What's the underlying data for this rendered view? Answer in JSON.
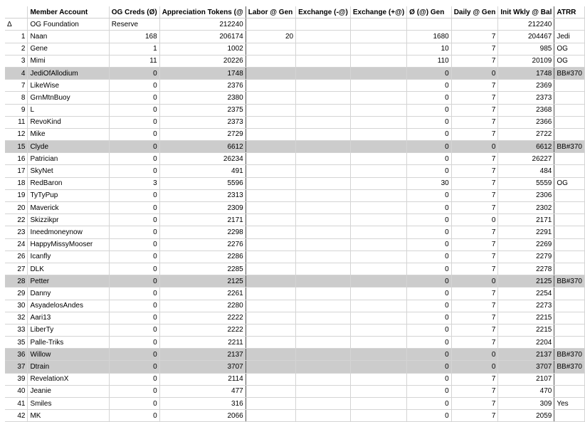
{
  "columns": {
    "idx": "",
    "account": "Member Account",
    "og": "OG Creds (Ø)",
    "tokens": "Appreciation Tokens (@",
    "labor": "Labor @ Gen",
    "exneg": "Exchange (-@)",
    "expos": "Exchange (+@)",
    "ogen": "Ø (@) Gen",
    "daily": "Daily @ Gen",
    "init": "Init Wkly @ Bal",
    "atrr": "ATRR"
  },
  "rows": [
    {
      "idx": "Δ",
      "account": "OG Foundation",
      "og": "Reserve",
      "tokens": "212240",
      "labor": "",
      "exneg": "",
      "expos": "",
      "ogen": "",
      "daily": "",
      "init": "212240",
      "atrr": "",
      "hl": false
    },
    {
      "idx": "1",
      "account": "Naan",
      "og": "168",
      "tokens": "206174",
      "labor": "20",
      "exneg": "",
      "expos": "",
      "ogen": "1680",
      "daily": "7",
      "init": "204467",
      "atrr": "Jedi",
      "hl": false
    },
    {
      "idx": "2",
      "account": "Gene",
      "og": "1",
      "tokens": "1002",
      "labor": "",
      "exneg": "",
      "expos": "",
      "ogen": "10",
      "daily": "7",
      "init": "985",
      "atrr": "OG",
      "hl": false
    },
    {
      "idx": "3",
      "account": "Mimi",
      "og": "11",
      "tokens": "20226",
      "labor": "",
      "exneg": "",
      "expos": "",
      "ogen": "110",
      "daily": "7",
      "init": "20109",
      "atrr": "OG",
      "hl": false
    },
    {
      "idx": "4",
      "account": "JediOfAllodium",
      "og": "0",
      "tokens": "1748",
      "labor": "",
      "exneg": "",
      "expos": "",
      "ogen": "0",
      "daily": "0",
      "init": "1748",
      "atrr": "BB#370",
      "hl": true
    },
    {
      "idx": "7",
      "account": "LikeWise",
      "og": "0",
      "tokens": "2376",
      "labor": "",
      "exneg": "",
      "expos": "",
      "ogen": "0",
      "daily": "7",
      "init": "2369",
      "atrr": "",
      "hl": false
    },
    {
      "idx": "8",
      "account": "GrnMtnBuoy",
      "og": "0",
      "tokens": "2380",
      "labor": "",
      "exneg": "",
      "expos": "",
      "ogen": "0",
      "daily": "7",
      "init": "2373",
      "atrr": "",
      "hl": false
    },
    {
      "idx": "9",
      "account": "L",
      "og": "0",
      "tokens": "2375",
      "labor": "",
      "exneg": "",
      "expos": "",
      "ogen": "0",
      "daily": "7",
      "init": "2368",
      "atrr": "",
      "hl": false
    },
    {
      "idx": "11",
      "account": "RevoKind",
      "og": "0",
      "tokens": "2373",
      "labor": "",
      "exneg": "",
      "expos": "",
      "ogen": "0",
      "daily": "7",
      "init": "2366",
      "atrr": "",
      "hl": false
    },
    {
      "idx": "12",
      "account": "Mike",
      "og": "0",
      "tokens": "2729",
      "labor": "",
      "exneg": "",
      "expos": "",
      "ogen": "0",
      "daily": "7",
      "init": "2722",
      "atrr": "",
      "hl": false
    },
    {
      "idx": "15",
      "account": "Clyde",
      "og": "0",
      "tokens": "6612",
      "labor": "",
      "exneg": "",
      "expos": "",
      "ogen": "0",
      "daily": "0",
      "init": "6612",
      "atrr": "BB#370",
      "hl": true
    },
    {
      "idx": "16",
      "account": "Patrician",
      "og": "0",
      "tokens": "26234",
      "labor": "",
      "exneg": "",
      "expos": "",
      "ogen": "0",
      "daily": "7",
      "init": "26227",
      "atrr": "",
      "hl": false
    },
    {
      "idx": "17",
      "account": "SkyNet",
      "og": "0",
      "tokens": "491",
      "labor": "",
      "exneg": "",
      "expos": "",
      "ogen": "0",
      "daily": "7",
      "init": "484",
      "atrr": "",
      "hl": false
    },
    {
      "idx": "18",
      "account": "RedBaron",
      "og": "3",
      "tokens": "5596",
      "labor": "",
      "exneg": "",
      "expos": "",
      "ogen": "30",
      "daily": "7",
      "init": "5559",
      "atrr": "OG",
      "hl": false
    },
    {
      "idx": "19",
      "account": "TyTyPup",
      "og": "0",
      "tokens": "2313",
      "labor": "",
      "exneg": "",
      "expos": "",
      "ogen": "0",
      "daily": "7",
      "init": "2306",
      "atrr": "",
      "hl": false
    },
    {
      "idx": "20",
      "account": "Maverick",
      "og": "0",
      "tokens": "2309",
      "labor": "",
      "exneg": "",
      "expos": "",
      "ogen": "0",
      "daily": "7",
      "init": "2302",
      "atrr": "",
      "hl": false
    },
    {
      "idx": "22",
      "account": "Skizzikpr",
      "og": "0",
      "tokens": "2171",
      "labor": "",
      "exneg": "",
      "expos": "",
      "ogen": "0",
      "daily": "0",
      "init": "2171",
      "atrr": "",
      "hl": false
    },
    {
      "idx": "23",
      "account": "Ineedmoneynow",
      "og": "0",
      "tokens": "2298",
      "labor": "",
      "exneg": "",
      "expos": "",
      "ogen": "0",
      "daily": "7",
      "init": "2291",
      "atrr": "",
      "hl": false
    },
    {
      "idx": "24",
      "account": "HappyMissyMooser",
      "og": "0",
      "tokens": "2276",
      "labor": "",
      "exneg": "",
      "expos": "",
      "ogen": "0",
      "daily": "7",
      "init": "2269",
      "atrr": "",
      "hl": false
    },
    {
      "idx": "26",
      "account": "Icanfly",
      "og": "0",
      "tokens": "2286",
      "labor": "",
      "exneg": "",
      "expos": "",
      "ogen": "0",
      "daily": "7",
      "init": "2279",
      "atrr": "",
      "hl": false
    },
    {
      "idx": "27",
      "account": "DLK",
      "og": "0",
      "tokens": "2285",
      "labor": "",
      "exneg": "",
      "expos": "",
      "ogen": "0",
      "daily": "7",
      "init": "2278",
      "atrr": "",
      "hl": false
    },
    {
      "idx": "28",
      "account": "Petter",
      "og": "0",
      "tokens": "2125",
      "labor": "",
      "exneg": "",
      "expos": "",
      "ogen": "0",
      "daily": "0",
      "init": "2125",
      "atrr": "BB#370",
      "hl": true
    },
    {
      "idx": "29",
      "account": "Danny",
      "og": "0",
      "tokens": "2261",
      "labor": "",
      "exneg": "",
      "expos": "",
      "ogen": "0",
      "daily": "7",
      "init": "2254",
      "atrr": "",
      "hl": false
    },
    {
      "idx": "30",
      "account": "AsyadelosAndes",
      "og": "0",
      "tokens": "2280",
      "labor": "",
      "exneg": "",
      "expos": "",
      "ogen": "0",
      "daily": "7",
      "init": "2273",
      "atrr": "",
      "hl": false
    },
    {
      "idx": "32",
      "account": "Aari13",
      "og": "0",
      "tokens": "2222",
      "labor": "",
      "exneg": "",
      "expos": "",
      "ogen": "0",
      "daily": "7",
      "init": "2215",
      "atrr": "",
      "hl": false
    },
    {
      "idx": "33",
      "account": "LiberTy",
      "og": "0",
      "tokens": "2222",
      "labor": "",
      "exneg": "",
      "expos": "",
      "ogen": "0",
      "daily": "7",
      "init": "2215",
      "atrr": "",
      "hl": false
    },
    {
      "idx": "35",
      "account": "Palle-Triks",
      "og": "0",
      "tokens": "2211",
      "labor": "",
      "exneg": "",
      "expos": "",
      "ogen": "0",
      "daily": "7",
      "init": "2204",
      "atrr": "",
      "hl": false
    },
    {
      "idx": "36",
      "account": "Willow",
      "og": "0",
      "tokens": "2137",
      "labor": "",
      "exneg": "",
      "expos": "",
      "ogen": "0",
      "daily": "0",
      "init": "2137",
      "atrr": "BB#370",
      "hl": true
    },
    {
      "idx": "37",
      "account": "Dtrain",
      "og": "0",
      "tokens": "3707",
      "labor": "",
      "exneg": "",
      "expos": "",
      "ogen": "0",
      "daily": "0",
      "init": "3707",
      "atrr": "BB#370",
      "hl": true
    },
    {
      "idx": "39",
      "account": "RevelationX",
      "og": "0",
      "tokens": "2114",
      "labor": "",
      "exneg": "",
      "expos": "",
      "ogen": "0",
      "daily": "7",
      "init": "2107",
      "atrr": "",
      "hl": false
    },
    {
      "idx": "40",
      "account": "Jeanie",
      "og": "0",
      "tokens": "477",
      "labor": "",
      "exneg": "",
      "expos": "",
      "ogen": "0",
      "daily": "7",
      "init": "470",
      "atrr": "",
      "hl": false
    },
    {
      "idx": "41",
      "account": "Smiles",
      "og": "0",
      "tokens": "316",
      "labor": "",
      "exneg": "",
      "expos": "",
      "ogen": "0",
      "daily": "7",
      "init": "309",
      "atrr": "Yes",
      "hl": false
    },
    {
      "idx": "42",
      "account": "MK",
      "og": "0",
      "tokens": "2066",
      "labor": "",
      "exneg": "",
      "expos": "",
      "ogen": "0",
      "daily": "7",
      "init": "2059",
      "atrr": "",
      "hl": false
    }
  ]
}
